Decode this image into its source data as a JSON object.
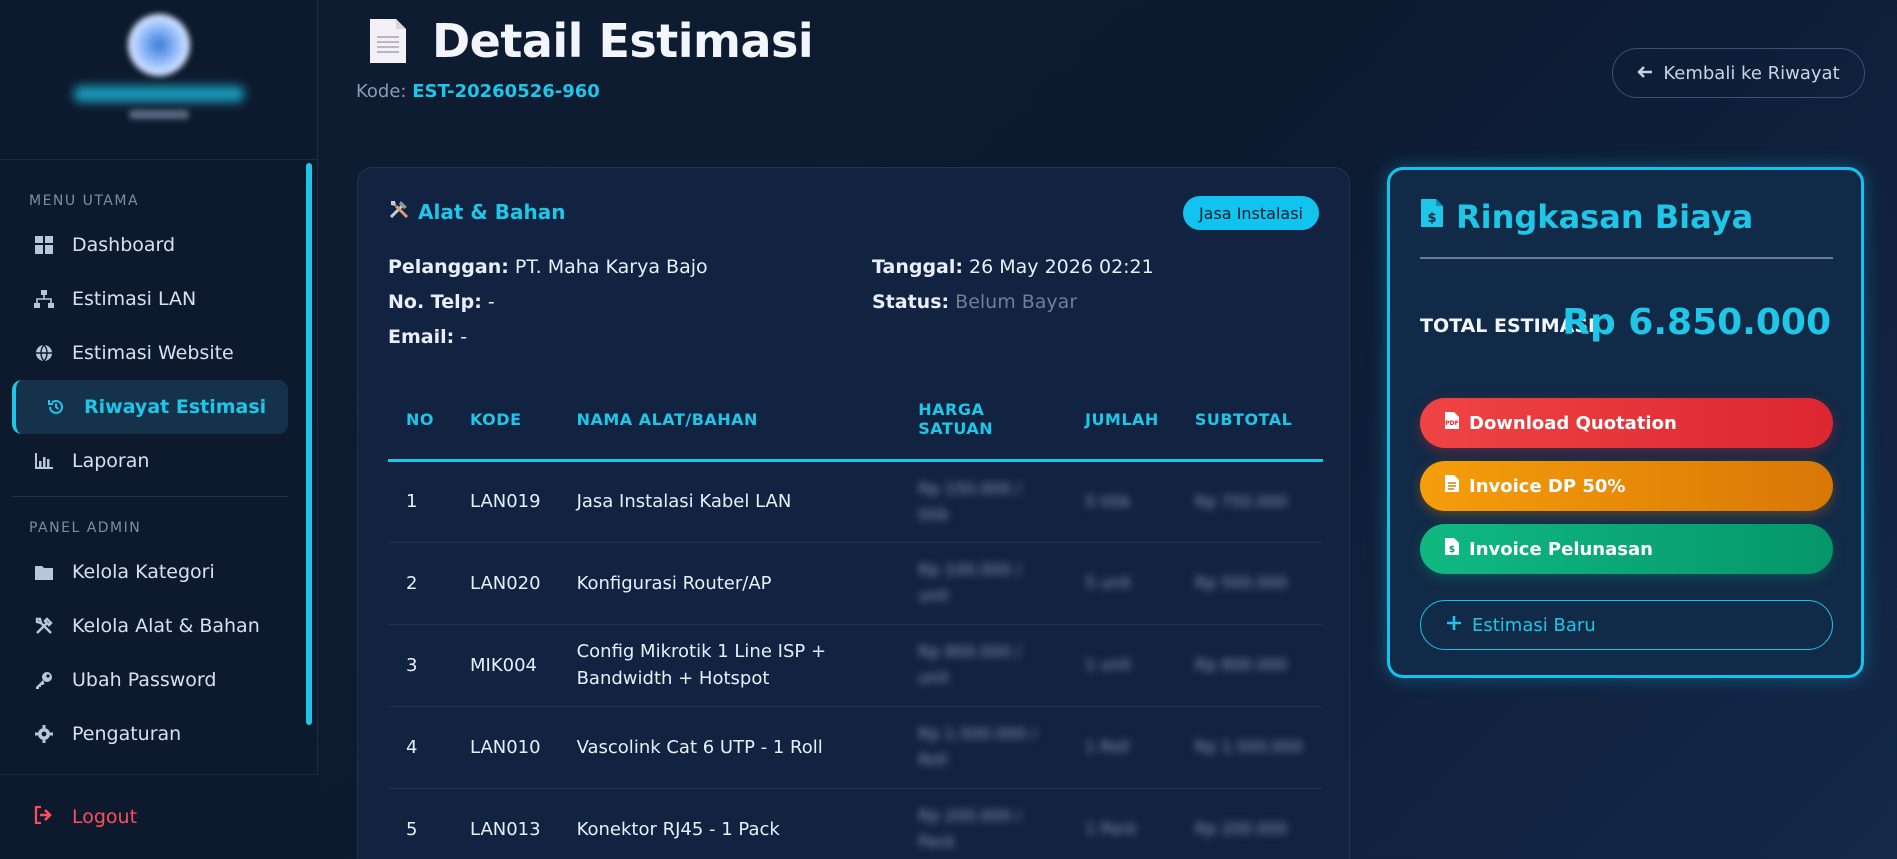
{
  "sidebar": {
    "section_main": "MENU UTAMA",
    "section_admin": "PANEL ADMIN",
    "main_items": [
      {
        "label": "Dashboard",
        "icon": "grid-icon"
      },
      {
        "label": "Estimasi LAN",
        "icon": "network-icon"
      },
      {
        "label": "Estimasi Website",
        "icon": "globe-icon"
      },
      {
        "label": "Riwayat Estimasi",
        "icon": "history-icon",
        "active": true
      },
      {
        "label": "Laporan",
        "icon": "chart-icon"
      }
    ],
    "admin_items": [
      {
        "label": "Kelola Kategori",
        "icon": "folder-icon"
      },
      {
        "label": "Kelola Alat & Bahan",
        "icon": "tools-icon"
      },
      {
        "label": "Ubah Password",
        "icon": "key-icon"
      },
      {
        "label": "Pengaturan",
        "icon": "gear-icon"
      }
    ],
    "logout": "Logout"
  },
  "header": {
    "title": "Detail Estimasi",
    "kode_label": "Kode:",
    "kode_value": "EST-20260526-960",
    "back_button": "Kembali ke Riwayat"
  },
  "detail": {
    "section_title": "Alat & Bahan",
    "tag": "Jasa Instalasi",
    "pelanggan_label": "Pelanggan:",
    "pelanggan_value": "PT. Maha Karya Bajo",
    "telp_label": "No. Telp:",
    "telp_value": "-",
    "email_label": "Email:",
    "email_value": "-",
    "tanggal_label": "Tanggal:",
    "tanggal_value": "26 May 2026 02:21",
    "status_label": "Status:",
    "status_value": "Belum Bayar"
  },
  "table": {
    "headers": [
      "NO",
      "KODE",
      "NAMA ALAT/BAHAN",
      "HARGA SATUAN",
      "JUMLAH",
      "SUBTOTAL"
    ],
    "rows": [
      {
        "no": "1",
        "kode": "LAN019",
        "nama": "Jasa Instalasi Kabel LAN",
        "harga": "Rp 150.000 / titik",
        "jumlah": "5 titik",
        "subtotal": "Rp 750.000"
      },
      {
        "no": "2",
        "kode": "LAN020",
        "nama": "Konfigurasi Router/AP",
        "harga": "Rp 100.000 / unit",
        "jumlah": "5 unit",
        "subtotal": "Rp 500.000"
      },
      {
        "no": "3",
        "kode": "MIK004",
        "nama": "Config Mikrotik 1 Line ISP + Bandwidth + Hotspot",
        "harga": "Rp 800.000 / unit",
        "jumlah": "1 unit",
        "subtotal": "Rp 800.000"
      },
      {
        "no": "4",
        "kode": "LAN010",
        "nama": "Vascolink Cat 6 UTP - 1 Roll",
        "harga": "Rp 1.500.000 / Roll",
        "jumlah": "1 Roll",
        "subtotal": "Rp 1.500.000"
      },
      {
        "no": "5",
        "kode": "LAN013",
        "nama": "Konektor RJ45 - 1 Pack",
        "harga": "Rp 200.000 / Pack",
        "jumlah": "1 Pack",
        "subtotal": "Rp 200.000"
      }
    ]
  },
  "summary": {
    "title": "Ringkasan Biaya",
    "total_label": "TOTAL ESTIMASI",
    "total_value": "Rp 6.850.000",
    "btn_download": "Download Quotation",
    "btn_dp": "Invoice DP 50%",
    "btn_pelunasan": "Invoice Pelunasan",
    "btn_new": "Estimasi Baru"
  },
  "colors": {
    "accent": "#1ec6e8",
    "danger": "#ef4444",
    "warning": "#f59e0b",
    "success": "#10b981",
    "background": "#0f1d33"
  }
}
